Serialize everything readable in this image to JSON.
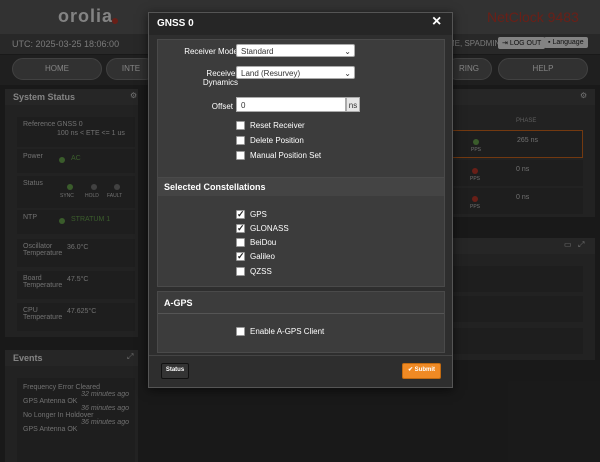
{
  "app": {
    "logo": "orolia",
    "title": "NetClock 9483",
    "utc": "UTC: 2025-03-25 18:06:00",
    "user": "ME, SPADMIN",
    "logout": "LOG OUT",
    "language": "Language"
  },
  "nav": [
    "HOME",
    "INTE",
    "RING",
    "HELP"
  ],
  "system_status": {
    "title": "System Status",
    "reference_label": "Reference",
    "reference_value": "GNSS 0",
    "reference_detail": "100 ns < ETE <= 1 us",
    "power_label": "Power",
    "power_value": "AC",
    "status_label": "Status",
    "status_items": [
      "SYNC",
      "HOLD",
      "FAULT"
    ],
    "ntp_label": "NTP",
    "ntp_value": "STRATUM 1",
    "osc_label": "Oscillator Temperature",
    "osc_value": "36.0°C",
    "board_label": "Board Temperature",
    "board_value": "47.5°C",
    "cpu_label": "CPU Temperature",
    "cpu_value": "47.625°C"
  },
  "phase_table": {
    "header": "PHASE",
    "rows": [
      {
        "pps": "PPS",
        "phase": "265 ns",
        "led": "green"
      },
      {
        "pps": "PPS",
        "phase": "0 ns",
        "led": "red"
      },
      {
        "pps": "PPS",
        "phase": "0 ns",
        "led": "red"
      }
    ]
  },
  "events": {
    "title": "Events",
    "items": [
      {
        "text": "Frequency Error Cleared",
        "time": "32 minutes ago"
      },
      {
        "text": "GPS Antenna OK",
        "time": "36 minutes ago"
      },
      {
        "text": "No Longer In Holdover",
        "time": "36 minutes ago"
      },
      {
        "text": "GPS Antenna OK",
        "time": ""
      }
    ]
  },
  "modal": {
    "title": "GNSS 0",
    "close": "×",
    "receiver_mode_label": "Receiver Mode",
    "receiver_mode_value": "Standard",
    "receiver_dynamics_label_1": "Receiver",
    "receiver_dynamics_label_2": "Dynamics",
    "receiver_dynamics_value": "Land (Resurvey)",
    "offset_label": "Offset",
    "offset_value": "0",
    "offset_unit": "ns",
    "options": [
      {
        "label": "Reset Receiver",
        "checked": false
      },
      {
        "label": "Delete Position",
        "checked": false
      },
      {
        "label": "Manual Position Set",
        "checked": false
      }
    ],
    "constellations_title": "Selected Constellations",
    "constellations": [
      {
        "label": "GPS",
        "checked": true
      },
      {
        "label": "GLONASS",
        "checked": true
      },
      {
        "label": "BeiDou",
        "checked": false
      },
      {
        "label": "Galileo",
        "checked": true
      },
      {
        "label": "QZSS",
        "checked": false
      }
    ],
    "agps_title": "A-GPS",
    "agps_option": "Enable A-GPS Client",
    "status_button": "Status",
    "submit_button": "Submit"
  }
}
